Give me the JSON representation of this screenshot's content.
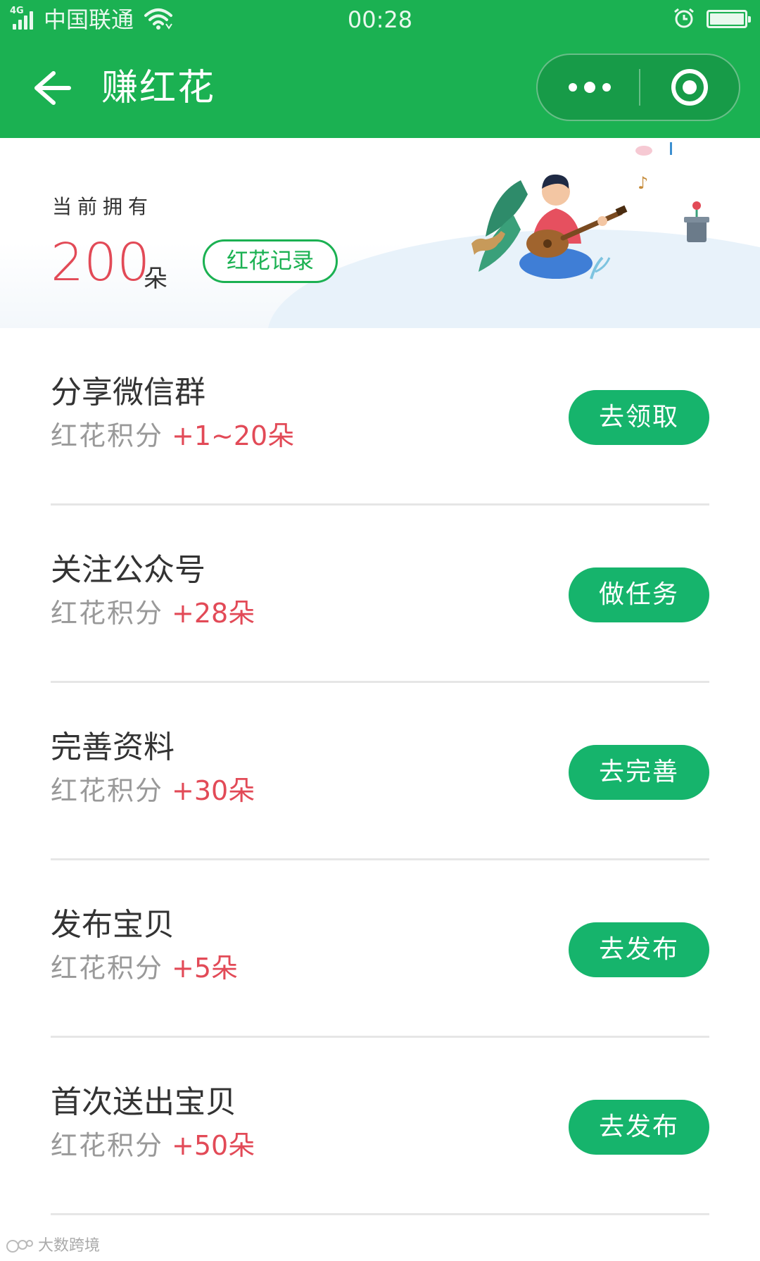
{
  "status_bar": {
    "network": "4G",
    "carrier": "中国联通",
    "time": "00:28",
    "text_color": "#e9f8ee"
  },
  "nav": {
    "title": "赚红花",
    "background": "#1bb152"
  },
  "summary": {
    "label": "当前拥有",
    "value": "200",
    "unit": "朵",
    "record_button": "红花记录",
    "value_color": "#e24a57"
  },
  "tasks": [
    {
      "name": "分享微信群",
      "points_label": "红花积分",
      "points_value": "+1~20朵",
      "action": "去领取"
    },
    {
      "name": "关注公众号",
      "points_label": "红花积分",
      "points_value": "+28朵",
      "action": "做任务"
    },
    {
      "name": "完善资料",
      "points_label": "红花积分",
      "points_value": "+30朵",
      "action": "去完善"
    },
    {
      "name": "发布宝贝",
      "points_label": "红花积分",
      "points_value": "+5朵",
      "action": "去发布"
    },
    {
      "name": "首次送出宝贝",
      "points_label": "红花积分",
      "points_value": "+50朵",
      "action": "去发布"
    }
  ],
  "watermark": {
    "text": "大数跨境"
  },
  "colors": {
    "accent": "#1bb152",
    "button": "#16b46c",
    "points": "#e24a57"
  }
}
